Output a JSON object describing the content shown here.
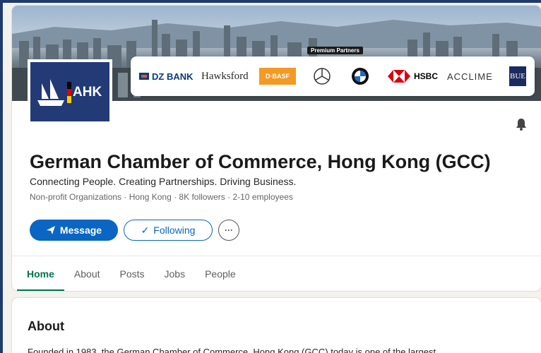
{
  "banner": {
    "partners_tag": "Premium Partners",
    "partners": {
      "dz_bank": "DZ BANK",
      "hawksford": "Hawksford",
      "basf": "D·BASF",
      "hsbc": "HSBC",
      "acclime": "ACCLIME",
      "bue": "BUE"
    }
  },
  "company": {
    "logo_text": "AHK",
    "name": "German Chamber of Commerce, Hong Kong (GCC)",
    "tagline": "Connecting People. Creating Partnerships. Driving Business.",
    "meta": "Non-profit Organizations · Hong Kong · 8K followers · 2-10 employees"
  },
  "actions": {
    "message_label": "Message",
    "following_label": "Following",
    "more_label": "···"
  },
  "tabs": [
    {
      "label": "Home",
      "active": true
    },
    {
      "label": "About"
    },
    {
      "label": "Posts"
    },
    {
      "label": "Jobs"
    },
    {
      "label": "People"
    }
  ],
  "about": {
    "title": "About",
    "text": "Founded in 1983, the German Chamber of Commerce, Hong Kong (GCC) today is one of the largest"
  },
  "colors": {
    "primary": "#0a66c2",
    "tab_active": "#01754f",
    "frame": "#1f3a6d"
  }
}
